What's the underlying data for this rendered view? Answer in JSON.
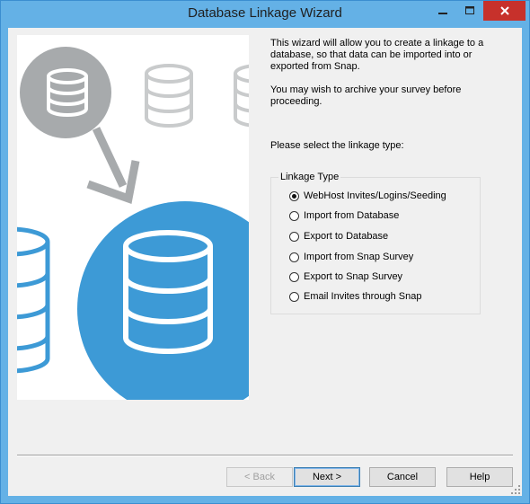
{
  "window": {
    "title": "Database Linkage Wizard"
  },
  "intro": {
    "line1": "This wizard will allow you to create a linkage to a",
    "line2": "database, so that data can be imported into or",
    "line3": "exported from Snap.",
    "archive1": "You may wish to archive your survey before",
    "archive2": "proceeding.",
    "prompt": "Please select the linkage type:"
  },
  "linkage": {
    "group_label": "Linkage Type",
    "options": [
      {
        "label": "WebHost Invites/Logins/Seeding",
        "selected": true
      },
      {
        "label": "Import from Database",
        "selected": false
      },
      {
        "label": "Export to Database",
        "selected": false
      },
      {
        "label": "Import from Snap Survey",
        "selected": false
      },
      {
        "label": "Export to Snap Survey",
        "selected": false
      },
      {
        "label": "Email Invites through Snap",
        "selected": false
      }
    ]
  },
  "buttons": {
    "back": "< Back",
    "next": "Next >",
    "cancel": "Cancel",
    "help": "Help"
  },
  "colors": {
    "frame": "#64b1e6",
    "close": "#c7312b",
    "gray_circle": "#a7aaac",
    "blue_circle": "#3d9ad6",
    "db_outline": "#c9cbcc"
  }
}
